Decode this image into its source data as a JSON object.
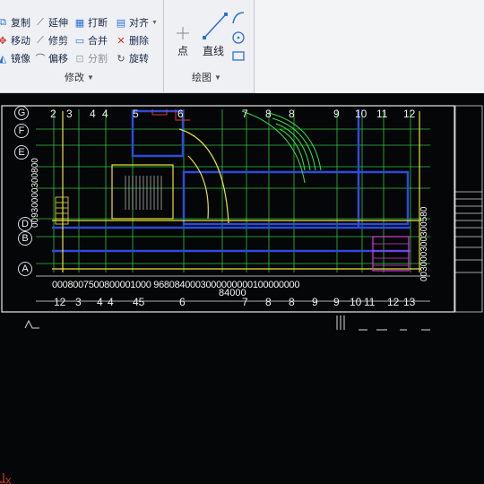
{
  "ribbon": {
    "modify": {
      "items": [
        {
          "label": "复制",
          "icon": "copy-icon"
        },
        {
          "label": "延伸",
          "icon": "extend-icon"
        },
        {
          "label": "打断",
          "icon": "break-icon"
        },
        {
          "label": "对齐",
          "icon": "align-icon"
        },
        {
          "label": "移动",
          "icon": "move-icon"
        },
        {
          "label": "修剪",
          "icon": "trim-icon"
        },
        {
          "label": "合并",
          "icon": "join-icon"
        },
        {
          "label": "删除",
          "icon": "erase-icon"
        },
        {
          "label": "镜像",
          "icon": "mirror-icon"
        },
        {
          "label": "偏移",
          "icon": "offset-icon"
        },
        {
          "label": "分割",
          "icon": "divide-icon"
        },
        {
          "label": "旋转",
          "icon": "rotate-icon"
        }
      ],
      "title": "修改"
    },
    "draw": {
      "point_label": "点",
      "line_label": "直线",
      "title": "绘图"
    }
  },
  "canvas": {
    "top_axis_numbers": [
      "2",
      "3",
      "4",
      "4",
      "5",
      "6",
      "7",
      "8",
      "8",
      "9",
      "10",
      "11",
      "12"
    ],
    "bottom_axis_numbers": [
      "12",
      "3",
      "4",
      "4",
      "45",
      "6",
      "7",
      "8",
      "8",
      "9",
      "9",
      "10",
      "11",
      "12",
      "13"
    ],
    "left_axis_letters": [
      "G",
      "F",
      "E",
      "D",
      "B",
      "A"
    ],
    "dimension_string": "0008007500800001000 9680840003000000000100000000",
    "dimension_sub": "84000",
    "left_dims": "00930000300800",
    "right_dims": "003000300300580",
    "ucs_label": "X"
  },
  "colors": {
    "ribbon_bg": "#eef0f3",
    "canvas_bg": "#050607",
    "cad_green": "#38e04a",
    "cad_yellow": "#e8e23a",
    "cad_blue": "#2d4bd8",
    "cad_magenta": "#d63cd8",
    "cad_red": "#e03a2a"
  }
}
